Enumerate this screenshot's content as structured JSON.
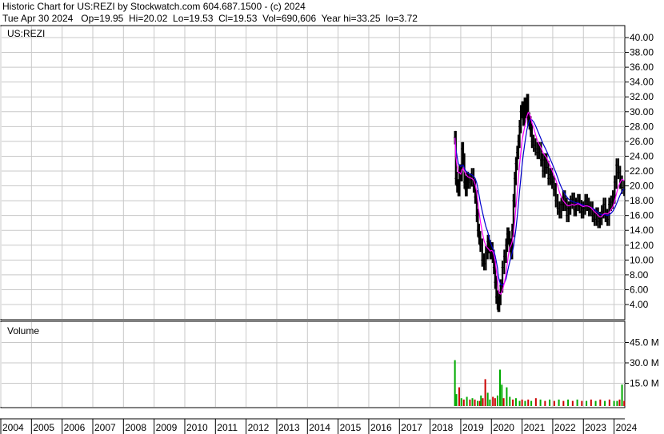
{
  "header": {
    "line1": "Historic Chart for US:REZI by Stockwatch.com 604.687.1500 - (c) 2024",
    "line2": "Tue Apr 30 2024   Op=19.95  Hi=20.02  Lo=19.53  Cl=19.53  Vol=690,606  Year hi=33.25  lo=3.72"
  },
  "colors": {
    "grid": "#c8c8c8",
    "price_bar": "#000000",
    "ma_short": "#ff00ff",
    "ma_long": "#0000cc",
    "vol_up": "#00aa00",
    "vol_down": "#cc0000"
  },
  "chart_data": [
    {
      "type": "line",
      "label": "US:REZI",
      "y_ticks": [
        "40.00",
        "38.00",
        "36.00",
        "34.00",
        "32.00",
        "30.00",
        "28.00",
        "26.00",
        "24.00",
        "22.00",
        "20.00",
        "18.00",
        "16.00",
        "14.00",
        "12.00",
        "10.00",
        "8.00",
        "6.00",
        "4.00"
      ],
      "ylim": [
        2,
        42
      ],
      "x_ticks": [
        "2004",
        "2005",
        "2006",
        "2007",
        "2008",
        "2009",
        "2010",
        "2011",
        "2012",
        "2013",
        "2014",
        "2015",
        "2016",
        "2017",
        "2018",
        "2019",
        "2020",
        "2021",
        "2022",
        "2023",
        "2024"
      ],
      "xlim": [
        2004.0,
        2024.35
      ],
      "grid": true,
      "series": [
        {
          "x": [
            2018.81,
            2018.84,
            2018.88,
            2018.92,
            2018.96,
            2019.0,
            2019.04,
            2019.08,
            2019.12,
            2019.16,
            2019.2,
            2019.24,
            2019.3,
            2019.36,
            2019.42,
            2019.47,
            2019.52,
            2019.56,
            2019.6,
            2019.64,
            2019.7,
            2019.76,
            2019.82,
            2019.88,
            2019.92,
            2019.96,
            2020.0,
            2020.04,
            2020.08,
            2020.12,
            2020.16,
            2020.2,
            2020.22,
            2020.26,
            2020.3,
            2020.36,
            2020.42,
            2020.48,
            2020.52,
            2020.56,
            2020.6,
            2020.64,
            2020.68,
            2020.72,
            2020.76,
            2020.8,
            2020.84,
            2020.88,
            2020.92,
            2020.96,
            2021.0,
            2021.04,
            2021.08,
            2021.12,
            2021.16,
            2021.2,
            2021.24,
            2021.28,
            2021.32,
            2021.38,
            2021.44,
            2021.5,
            2021.56,
            2021.62,
            2021.68,
            2021.74,
            2021.8,
            2021.86,
            2021.92,
            2021.98,
            2022.04,
            2022.1,
            2022.16,
            2022.22,
            2022.28,
            2022.34,
            2022.4,
            2022.46,
            2022.52,
            2022.58,
            2022.64,
            2022.7,
            2022.76,
            2022.82,
            2022.88,
            2022.94,
            2023.0,
            2023.06,
            2023.12,
            2023.18,
            2023.24,
            2023.3,
            2023.36,
            2023.42,
            2023.48,
            2023.54,
            2023.6,
            2023.66,
            2023.72,
            2023.78,
            2023.84,
            2023.9,
            2023.96,
            2024.02,
            2024.08,
            2024.14,
            2024.2,
            2024.26,
            2024.33
          ],
          "y": [
            26.5,
            21.0,
            20.0,
            19.5,
            22.0,
            21.5,
            25.0,
            23.5,
            20.5,
            19.5,
            21.0,
            20.5,
            20.8,
            21.5,
            20.0,
            18.5,
            16.0,
            14.0,
            13.0,
            12.0,
            10.0,
            9.5,
            11.0,
            12.5,
            11.8,
            11.0,
            11.5,
            10.5,
            9.0,
            7.0,
            5.0,
            4.2,
            3.9,
            4.8,
            6.5,
            9.0,
            10.5,
            12.0,
            13.5,
            13.0,
            12.0,
            11.0,
            14.0,
            18.0,
            21.0,
            23.0,
            24.5,
            26.0,
            28.0,
            30.0,
            30.5,
            29.0,
            31.0,
            30.0,
            31.5,
            29.0,
            28.5,
            27.5,
            26.0,
            25.5,
            25.0,
            24.5,
            25.0,
            23.5,
            22.0,
            23.5,
            22.5,
            21.0,
            21.5,
            20.5,
            19.5,
            18.0,
            17.0,
            16.5,
            17.5,
            18.5,
            17.5,
            16.0,
            17.0,
            17.8,
            18.2,
            16.8,
            17.5,
            18.0,
            17.2,
            16.5,
            17.0,
            18.0,
            17.5,
            16.8,
            17.0,
            16.0,
            15.5,
            16.2,
            15.2,
            15.6,
            16.5,
            17.5,
            16.0,
            15.5,
            17.5,
            17.8,
            18.5,
            20.5,
            22.8,
            21.8,
            20.5,
            19.8,
            19.53
          ],
          "ma_short": [
            26.5,
            24.0,
            22.7,
            21.8,
            21.8,
            21.6,
            22.2,
            22.4,
            22.0,
            21.6,
            21.4,
            21.2,
            21.1,
            21.0,
            20.8,
            20.2,
            19.2,
            17.8,
            16.4,
            15.2,
            13.8,
            12.6,
            11.9,
            11.6,
            11.4,
            11.2,
            11.3,
            11.2,
            10.7,
            9.9,
            8.6,
            7.3,
            6.2,
            5.5,
            5.4,
            5.9,
            6.9,
            8.2,
            9.6,
            10.8,
            11.7,
            12.0,
            12.5,
            13.6,
            15.2,
            17.1,
            19.1,
            21.0,
            22.9,
            24.6,
            26.1,
            27.0,
            27.9,
            28.6,
            29.4,
            29.9,
            29.7,
            29.3,
            28.5,
            27.8,
            26.9,
            26.1,
            25.6,
            25.1,
            24.5,
            24.1,
            23.8,
            23.2,
            22.7,
            22.1,
            21.4,
            20.8,
            20.0,
            19.1,
            18.5,
            18.0,
            17.7,
            17.4,
            17.3,
            17.4,
            17.5,
            17.4,
            17.5,
            17.6,
            17.5,
            17.3,
            17.2,
            17.3,
            17.3,
            17.2,
            17.1,
            16.8,
            16.5,
            16.3,
            16.0,
            15.8,
            15.9,
            16.2,
            16.3,
            16.2,
            16.4,
            16.8,
            17.2,
            17.9,
            19.0,
            19.9,
            20.5,
            20.9,
            20.7
          ],
          "ma_long": [
            26.5,
            25.0,
            24.0,
            23.0,
            22.8,
            22.6,
            22.8,
            22.8,
            22.4,
            22.0,
            21.9,
            21.7,
            21.6,
            21.5,
            21.3,
            21.0,
            20.4,
            19.6,
            18.7,
            17.7,
            16.6,
            15.5,
            14.5,
            13.8,
            13.1,
            12.5,
            12.0,
            11.6,
            11.2,
            10.6,
            9.8,
            8.9,
            8.0,
            7.2,
            6.7,
            6.6,
            6.9,
            7.5,
            8.3,
            9.1,
            9.8,
            10.4,
            11.0,
            11.8,
            12.9,
            14.2,
            15.8,
            17.5,
            19.3,
            21.1,
            22.8,
            24.2,
            25.5,
            26.6,
            27.6,
            28.3,
            28.8,
            29.0,
            28.9,
            28.6,
            28.1,
            27.5,
            26.9,
            26.3,
            25.7,
            25.2,
            24.7,
            24.1,
            23.6,
            23.0,
            22.4,
            21.8,
            21.1,
            20.4,
            19.8,
            19.3,
            18.9,
            18.5,
            18.2,
            18.0,
            17.9,
            17.8,
            17.7,
            17.7,
            17.6,
            17.5,
            17.4,
            17.3,
            17.3,
            17.2,
            17.1,
            17.0,
            16.8,
            16.6,
            16.4,
            16.2,
            16.1,
            16.1,
            16.1,
            16.0,
            16.1,
            16.3,
            16.6,
            17.0,
            17.6,
            18.2,
            18.8,
            19.3,
            19.6
          ]
        }
      ]
    },
    {
      "type": "bar",
      "label": "Volume",
      "y_ticks": [
        "45.0 M",
        "30.0 M",
        "15.0 M"
      ],
      "ylim": [
        0,
        55
      ],
      "x": [
        2018.81,
        2018.86,
        2018.95,
        2019.02,
        2019.1,
        2019.2,
        2019.3,
        2019.38,
        2019.46,
        2019.55,
        2019.62,
        2019.66,
        2019.72,
        2019.8,
        2019.88,
        2019.95,
        2020.05,
        2020.12,
        2020.2,
        2020.28,
        2020.34,
        2020.4,
        2020.5,
        2020.6,
        2020.7,
        2020.8,
        2020.92,
        2021.0,
        2021.1,
        2021.2,
        2021.3,
        2021.45,
        2021.6,
        2021.75,
        2021.9,
        2022.05,
        2022.2,
        2022.35,
        2022.5,
        2022.65,
        2022.8,
        2022.95,
        2023.1,
        2023.25,
        2023.4,
        2023.55,
        2023.7,
        2023.85,
        2024.0,
        2024.1,
        2024.18,
        2024.26,
        2024.33
      ],
      "values": [
        32,
        7,
        12,
        4,
        3,
        5,
        3,
        4,
        3,
        2,
        2,
        6,
        4,
        18,
        8,
        3,
        5,
        4,
        6,
        25,
        14,
        4,
        12,
        5,
        3,
        4,
        2,
        3,
        2,
        3,
        2,
        4,
        3,
        2,
        3,
        2,
        3,
        2,
        3,
        2,
        3,
        2,
        2,
        3,
        2,
        3,
        2,
        3,
        2,
        2,
        3,
        14,
        2
      ],
      "up": [
        true,
        true,
        false,
        true,
        false,
        true,
        false,
        true,
        false,
        true,
        false,
        true,
        false,
        false,
        true,
        true,
        false,
        false,
        true,
        true,
        true,
        false,
        true,
        true,
        false,
        true,
        true,
        false,
        true,
        false,
        true,
        false,
        true,
        false,
        true,
        false,
        true,
        false,
        true,
        false,
        true,
        false,
        true,
        false,
        true,
        false,
        true,
        false,
        true,
        true,
        false,
        true,
        false
      ]
    }
  ]
}
